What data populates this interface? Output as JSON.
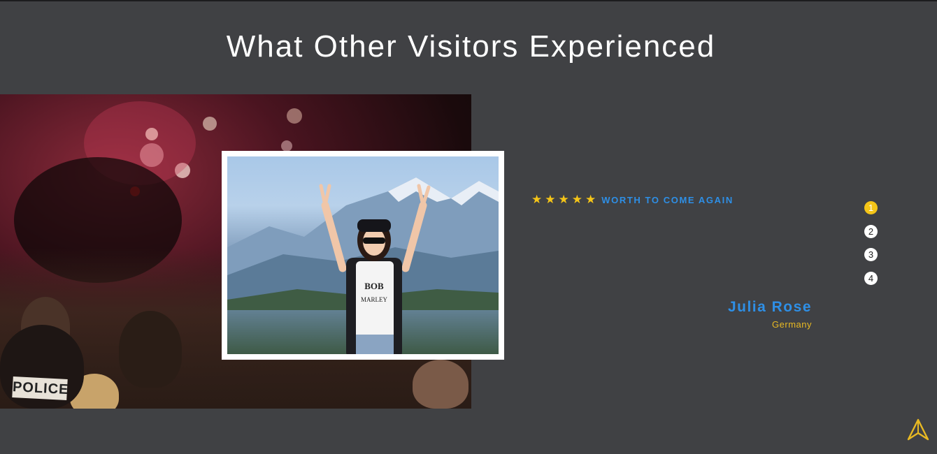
{
  "section": {
    "title": "What Other Visitors Experienced"
  },
  "background_photo": {
    "badge_text": "POLICE"
  },
  "testimonial": {
    "stars": 5,
    "headline": "Worth to come again",
    "text": "",
    "name": "Julia Rose",
    "country": "Germany"
  },
  "pager": {
    "pages": [
      "1",
      "2",
      "3",
      "4"
    ],
    "active": 0
  },
  "colors": {
    "background": "#404144",
    "accent_blue": "#2e8fe6",
    "accent_yellow": "#f5c518"
  },
  "icons": {
    "scroll_top": "navigation-arrow-icon",
    "rating": "star-icon"
  }
}
